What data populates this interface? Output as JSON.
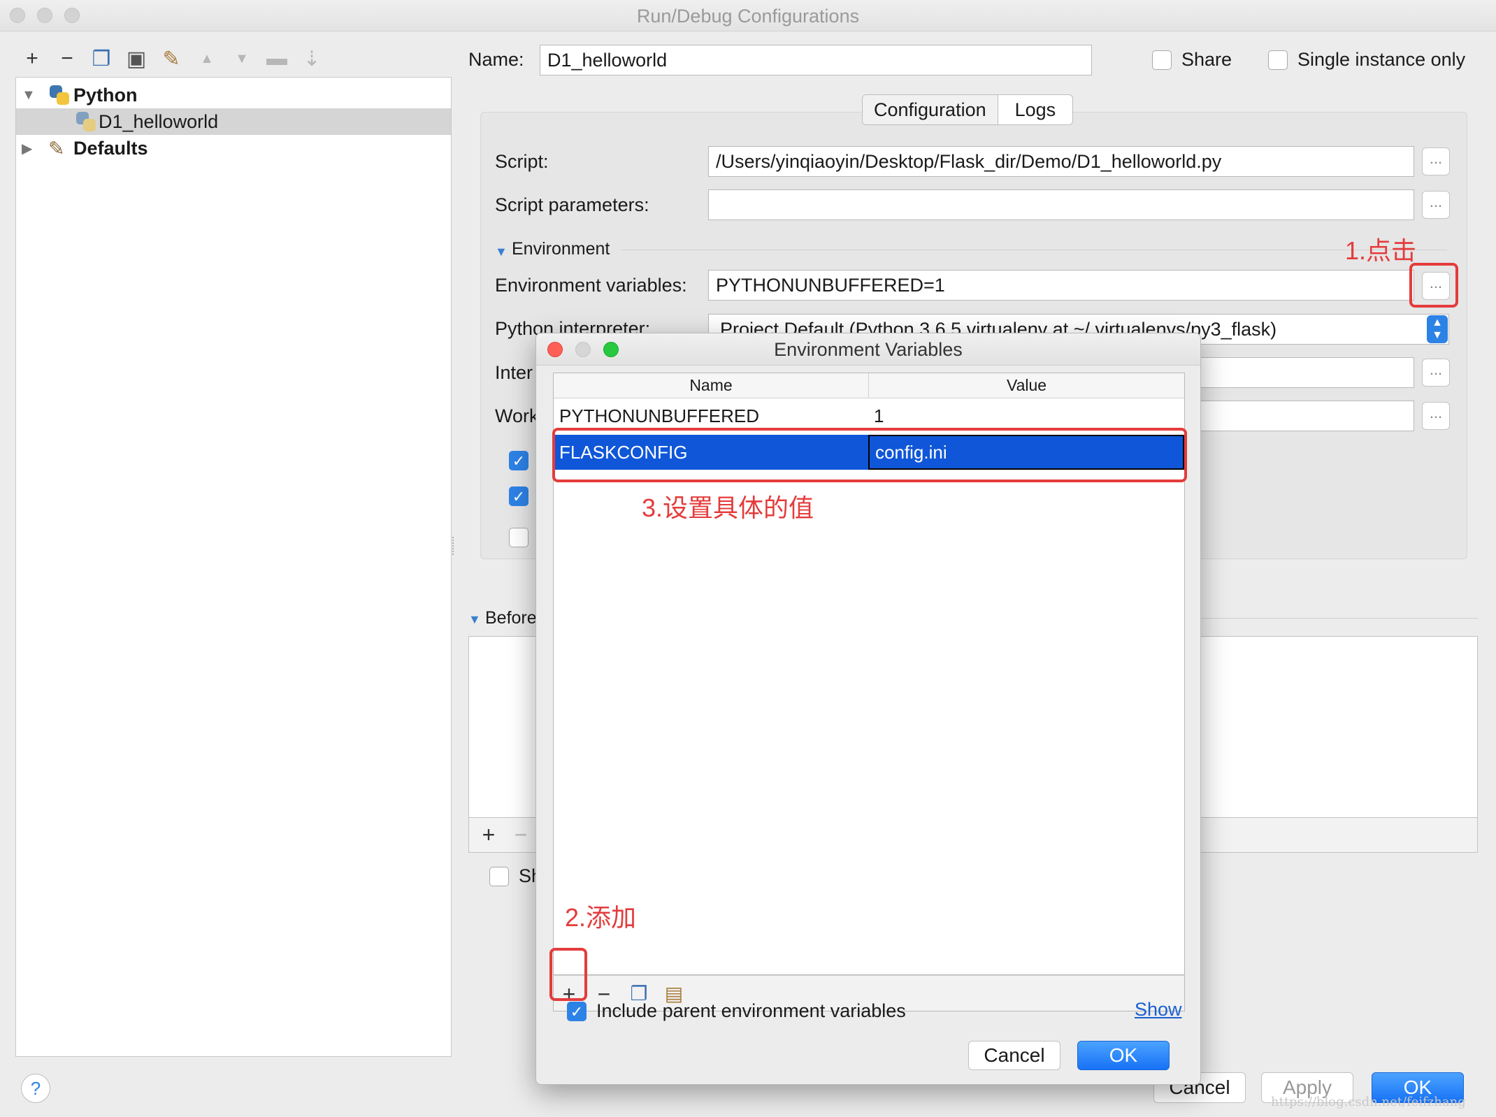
{
  "window": {
    "title": "Run/Debug Configurations"
  },
  "toolbar": {
    "icons": [
      "plus-icon",
      "minus-icon",
      "copy-icon",
      "save-icon",
      "wrench-icon",
      "arrow-up-icon",
      "arrow-down-icon",
      "folder-icon",
      "sort-icon"
    ],
    "glyphs": {
      "plus": "+",
      "minus": "−",
      "copy": "❐",
      "save": "▣",
      "wrench": "✎",
      "up": "▲",
      "down": "▼",
      "folder": "▬",
      "sort": "⇣"
    }
  },
  "tree": {
    "items": [
      {
        "label": "Python",
        "bold": true
      },
      {
        "label": "D1_helloworld",
        "bold": false
      },
      {
        "label": "Defaults",
        "bold": true
      }
    ]
  },
  "header": {
    "name_label": "Name:",
    "name_value": "D1_helloworld",
    "share_label": "Share",
    "single_instance_label": "Single instance only"
  },
  "tabs": [
    "Configuration",
    "Logs"
  ],
  "form": {
    "script_label": "Script:",
    "script_value": "/Users/yinqiaoyin/Desktop/Flask_dir/Demo/D1_helloworld.py",
    "script_params_label": "Script parameters:",
    "environment_label": "Environment",
    "env_vars_label": "Environment variables:",
    "env_vars_value": "PYTHONUNBUFFERED=1",
    "interpreter_label": "Python interpreter:",
    "interpreter_value": "Project Default (Python 3.6.5 virtualenv at ~/.virtualenvs/py3_flask)",
    "interpreter_opts_label": "Inter",
    "working_dir_label": "Work",
    "dots": "...",
    "before_label": "Before",
    "show_label": "Sh"
  },
  "bottom": {
    "help": "?",
    "cancel": "Cancel",
    "apply": "Apply",
    "ok": "OK",
    "watermark": "https://blog.csdn.net/feifzhang"
  },
  "dialog": {
    "title": "Environment Variables",
    "columns": [
      "Name",
      "Value"
    ],
    "rows": [
      {
        "name": "PYTHONUNBUFFERED",
        "value": "1"
      },
      {
        "name": "FLASKCONFIG",
        "value": "config.ini"
      }
    ],
    "include_parent_label": "Include parent environment variables",
    "show_link": "Show",
    "cancel": "Cancel",
    "ok": "OK"
  },
  "annotations": {
    "step1": "1.点击",
    "step2": "2.添加",
    "step3": "3.设置具体的值",
    "color": "#e43c3c"
  },
  "colors": {
    "accent": "#1772f5",
    "selection": "#0f57d8"
  }
}
